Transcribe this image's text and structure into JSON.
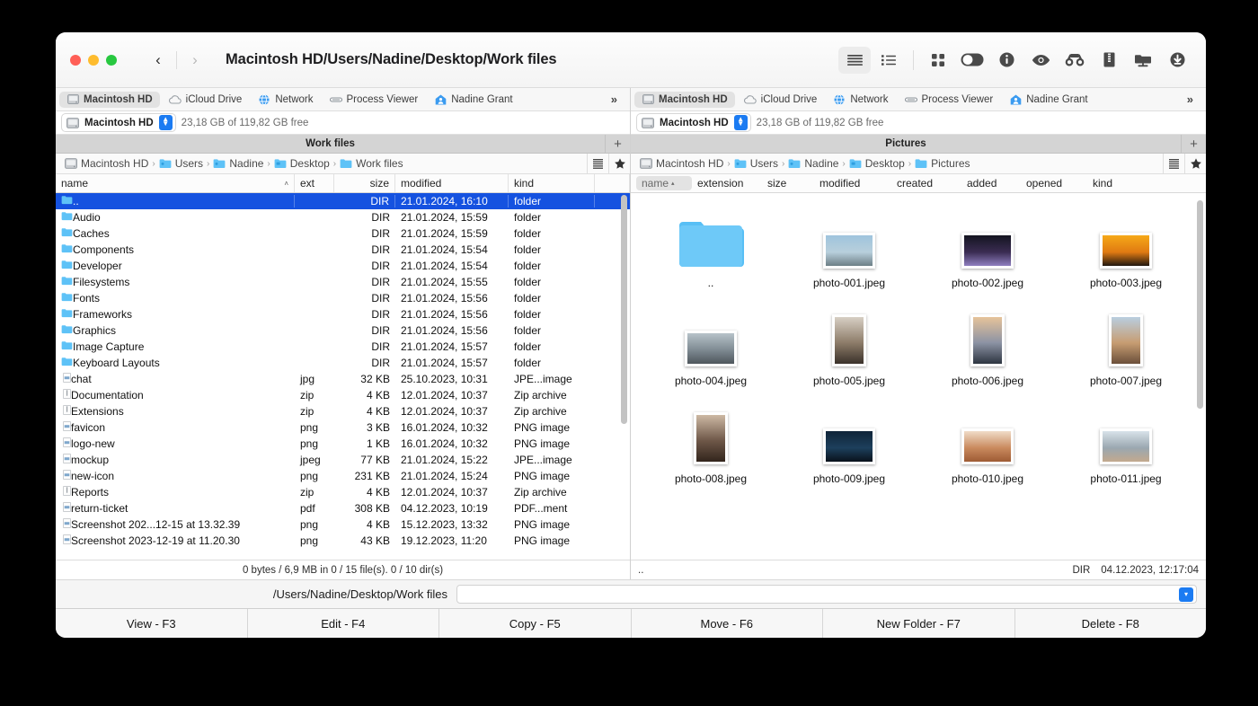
{
  "window": {
    "title": "Macintosh HD/Users/Nadine/Desktop/Work files",
    "back_glyph": "‹",
    "forward_glyph": "›"
  },
  "toolbar": {
    "items": [
      {
        "name": "brief-view-icon",
        "active": true
      },
      {
        "name": "full-view-icon",
        "active": false
      },
      {
        "name": "thumbnails-view-icon",
        "active": false
      },
      {
        "name": "toggle-switch-icon",
        "active": false
      },
      {
        "name": "info-icon",
        "active": false
      },
      {
        "name": "quicklook-eye-icon",
        "active": false
      },
      {
        "name": "find-binoculars-icon",
        "active": false
      },
      {
        "name": "archive-zip-icon",
        "active": false
      },
      {
        "name": "network-folder-icon",
        "active": false
      },
      {
        "name": "download-icon",
        "active": false
      }
    ]
  },
  "drive_tabs": {
    "items": [
      {
        "label": "Macintosh HD",
        "icon": "hard-disk-icon",
        "selected": true
      },
      {
        "label": "iCloud Drive",
        "icon": "cloud-icon",
        "selected": false
      },
      {
        "label": "Network",
        "icon": "globe-icon",
        "selected": false
      },
      {
        "label": "Process Viewer",
        "icon": "process-icon",
        "selected": false
      },
      {
        "label": "Nadine Grant",
        "icon": "home-user-icon",
        "selected": false
      }
    ],
    "overflow_label": "»"
  },
  "left_pane": {
    "drive": {
      "name": "Macintosh HD",
      "free": "23,18 GB of 119,82 GB free"
    },
    "tab_title": "Work files",
    "add_tab_label": "+",
    "breadcrumb": [
      "Macintosh HD",
      "Users",
      "Nadine",
      "Desktop",
      "Work files"
    ],
    "columns": [
      {
        "key": "name",
        "label": "name",
        "sort": "˄"
      },
      {
        "key": "ext",
        "label": "ext"
      },
      {
        "key": "size",
        "label": "size"
      },
      {
        "key": "modified",
        "label": "modified"
      },
      {
        "key": "kind",
        "label": "kind"
      }
    ],
    "rows": [
      {
        "name": "..",
        "ext": "",
        "size": "DIR",
        "modified": "21.01.2024, 16:10",
        "kind": "folder",
        "type": "folder",
        "selected": true
      },
      {
        "name": "Audio",
        "ext": "",
        "size": "DIR",
        "modified": "21.01.2024, 15:59",
        "kind": "folder",
        "type": "folder",
        "selected": false
      },
      {
        "name": "Caches",
        "ext": "",
        "size": "DIR",
        "modified": "21.01.2024, 15:59",
        "kind": "folder",
        "type": "folder",
        "selected": false
      },
      {
        "name": "Components",
        "ext": "",
        "size": "DIR",
        "modified": "21.01.2024, 15:54",
        "kind": "folder",
        "type": "folder",
        "selected": false
      },
      {
        "name": "Developer",
        "ext": "",
        "size": "DIR",
        "modified": "21.01.2024, 15:54",
        "kind": "folder",
        "type": "folder",
        "selected": false
      },
      {
        "name": "Filesystems",
        "ext": "",
        "size": "DIR",
        "modified": "21.01.2024, 15:55",
        "kind": "folder",
        "type": "folder",
        "selected": false
      },
      {
        "name": "Fonts",
        "ext": "",
        "size": "DIR",
        "modified": "21.01.2024, 15:56",
        "kind": "folder",
        "type": "folder",
        "selected": false
      },
      {
        "name": "Frameworks",
        "ext": "",
        "size": "DIR",
        "modified": "21.01.2024, 15:56",
        "kind": "folder",
        "type": "folder",
        "selected": false
      },
      {
        "name": "Graphics",
        "ext": "",
        "size": "DIR",
        "modified": "21.01.2024, 15:56",
        "kind": "folder",
        "type": "folder",
        "selected": false
      },
      {
        "name": "Image Capture",
        "ext": "",
        "size": "DIR",
        "modified": "21.01.2024, 15:57",
        "kind": "folder",
        "type": "folder",
        "selected": false
      },
      {
        "name": "Keyboard Layouts",
        "ext": "",
        "size": "DIR",
        "modified": "21.01.2024, 15:57",
        "kind": "folder",
        "type": "folder",
        "selected": false
      },
      {
        "name": "chat",
        "ext": "jpg",
        "size": "32 KB",
        "modified": "25.10.2023, 10:31",
        "kind": "JPE...image",
        "type": "image",
        "selected": false
      },
      {
        "name": "Documentation",
        "ext": "zip",
        "size": "4 KB",
        "modified": "12.01.2024, 10:37",
        "kind": "Zip archive",
        "type": "zip",
        "selected": false
      },
      {
        "name": "Extensions",
        "ext": "zip",
        "size": "4 KB",
        "modified": "12.01.2024, 10:37",
        "kind": "Zip archive",
        "type": "zip",
        "selected": false
      },
      {
        "name": "favicon",
        "ext": "png",
        "size": "3 KB",
        "modified": "16.01.2024, 10:32",
        "kind": "PNG image",
        "type": "image",
        "selected": false
      },
      {
        "name": "logo-new",
        "ext": "png",
        "size": "1 KB",
        "modified": "16.01.2024, 10:32",
        "kind": "PNG image",
        "type": "image",
        "selected": false
      },
      {
        "name": "mockup",
        "ext": "jpeg",
        "size": "77 KB",
        "modified": "21.01.2024, 15:22",
        "kind": "JPE...image",
        "type": "image",
        "selected": false
      },
      {
        "name": "new-icon",
        "ext": "png",
        "size": "231 KB",
        "modified": "21.01.2024, 15:24",
        "kind": "PNG image",
        "type": "image",
        "selected": false
      },
      {
        "name": "Reports",
        "ext": "zip",
        "size": "4 KB",
        "modified": "12.01.2024, 10:37",
        "kind": "Zip archive",
        "type": "zip",
        "selected": false
      },
      {
        "name": "return-ticket",
        "ext": "pdf",
        "size": "308 KB",
        "modified": "04.12.2023, 10:19",
        "kind": "PDF...ment",
        "type": "image",
        "selected": false
      },
      {
        "name": "Screenshot 202...12-15 at 13.32.39",
        "ext": "png",
        "size": "4 KB",
        "modified": "15.12.2023, 13:32",
        "kind": "PNG image",
        "type": "image",
        "selected": false
      },
      {
        "name": "Screenshot 2023-12-19 at 11.20.30",
        "ext": "png",
        "size": "43 KB",
        "modified": "19.12.2023, 11:20",
        "kind": "PNG image",
        "type": "image",
        "selected": false
      }
    ],
    "status": "0 bytes / 6,9 MB in 0 / 15 file(s). 0 / 10 dir(s)"
  },
  "right_pane": {
    "drive": {
      "name": "Macintosh HD",
      "free": "23,18 GB of 119,82 GB free"
    },
    "tab_title": "Pictures",
    "add_tab_label": "+",
    "breadcrumb": [
      "Macintosh HD",
      "Users",
      "Nadine",
      "Desktop",
      "Pictures"
    ],
    "columns": [
      {
        "key": "name",
        "label": "name",
        "sort": "▴",
        "active": true
      },
      {
        "key": "extension",
        "label": "extension"
      },
      {
        "key": "size",
        "label": "size"
      },
      {
        "key": "modified",
        "label": "modified"
      },
      {
        "key": "created",
        "label": "created"
      },
      {
        "key": "added",
        "label": "added"
      },
      {
        "key": "opened",
        "label": "opened"
      },
      {
        "key": "kind",
        "label": "kind"
      }
    ],
    "items": [
      {
        "label": "..",
        "type": "folder"
      },
      {
        "label": "photo-001.jpeg",
        "type": "image",
        "orientation": "landscape",
        "c1": "#9fc4dd",
        "c2": "#b8cfdc",
        "c3": "#6d7f86"
      },
      {
        "label": "photo-002.jpeg",
        "type": "image",
        "orientation": "landscape",
        "c1": "#141420",
        "c2": "#3a2c52",
        "c3": "#8f7fc0"
      },
      {
        "label": "photo-003.jpeg",
        "type": "image",
        "orientation": "landscape",
        "c1": "#f6a918",
        "c2": "#e07a12",
        "c3": "#20170f"
      },
      {
        "label": "photo-004.jpeg",
        "type": "image",
        "orientation": "landscape",
        "c1": "#b7c2c9",
        "c2": "#7e8a92",
        "c3": "#4e565c"
      },
      {
        "label": "photo-005.jpeg",
        "type": "image",
        "orientation": "portrait",
        "c1": "#d7cfc4",
        "c2": "#8d7c69",
        "c3": "#3a312a"
      },
      {
        "label": "photo-006.jpeg",
        "type": "image",
        "orientation": "portrait",
        "c1": "#e6c39a",
        "c2": "#8c93a4",
        "c3": "#2d3541"
      },
      {
        "label": "photo-007.jpeg",
        "type": "image",
        "orientation": "portrait",
        "c1": "#b9cee0",
        "c2": "#c79d72",
        "c3": "#6b4f3a"
      },
      {
        "label": "photo-008.jpeg",
        "type": "image",
        "orientation": "portrait",
        "c1": "#cdb9a4",
        "c2": "#6e5748",
        "c3": "#32251c"
      },
      {
        "label": "photo-009.jpeg",
        "type": "image",
        "orientation": "landscape",
        "c1": "#0f2438",
        "c2": "#1d3f5c",
        "c3": "#09111b"
      },
      {
        "label": "photo-010.jpeg",
        "type": "image",
        "orientation": "landscape",
        "c1": "#f0dcc8",
        "c2": "#c98a5e",
        "c3": "#9e5b34"
      },
      {
        "label": "photo-011.jpeg",
        "type": "image",
        "orientation": "landscape",
        "c1": "#d8e2e9",
        "c2": "#9aa7b0",
        "c3": "#c3a98e"
      }
    ],
    "status": {
      "left": "..",
      "size": "DIR",
      "date": "04.12.2023, 12:17:04"
    }
  },
  "command_bar": {
    "prompt": "/Users/Nadine/Desktop/Work files",
    "input_value": "",
    "dropdown_glyph": "▾"
  },
  "function_bar": {
    "buttons": [
      "View - F3",
      "Edit - F4",
      "Copy - F5",
      "Move - F6",
      "New Folder - F7",
      "Delete - F8"
    ]
  },
  "colors": {
    "selection_blue": "#1552e0",
    "accent_blue": "#1b7bf2",
    "folder_blue": "#5ec2f7",
    "traffic_red": "#ff5f57",
    "traffic_yellow": "#febc2e",
    "traffic_green": "#28c840"
  }
}
